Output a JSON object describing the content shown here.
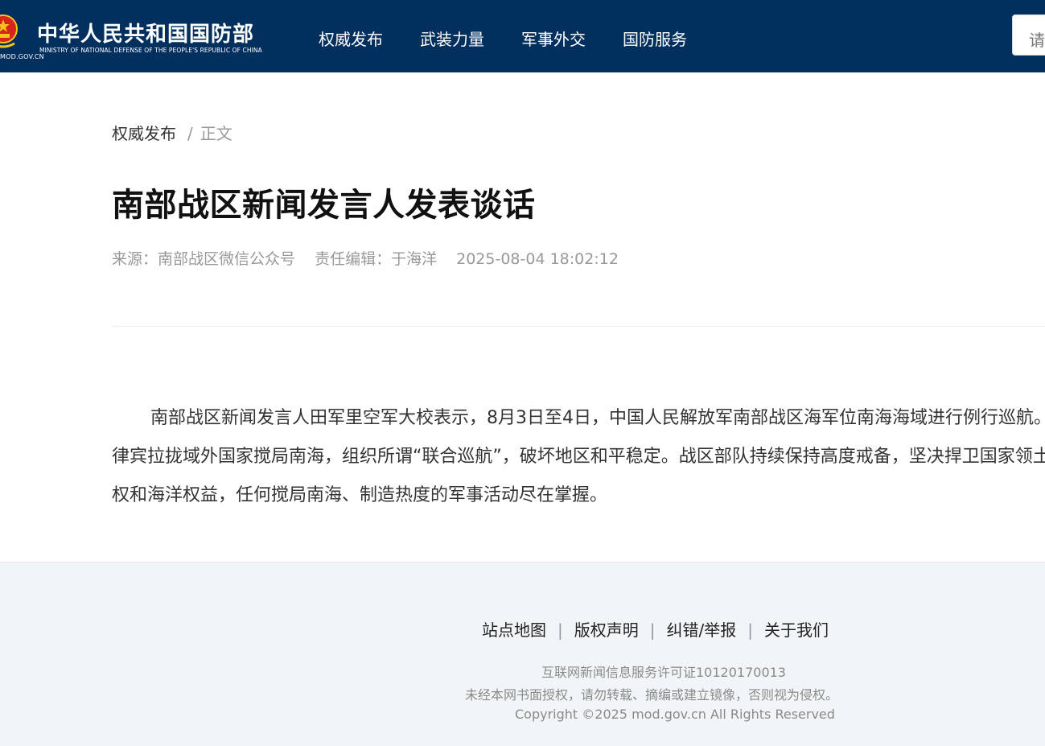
{
  "header": {
    "site_title": "中华人民共和国国防部",
    "site_subtitle": "MINISTRY OF NATIONAL DEFENSE OF THE PEOPLE'S REPUBLIC OF CHINA",
    "domain": "MOD.GOV.CN",
    "nav": [
      "权威发布",
      "武装力量",
      "军事外交",
      "国防服务"
    ],
    "search_placeholder": "请",
    "colors": {
      "bar": "#01305f",
      "emblem_red": "#d6261c",
      "emblem_gold": "#f5c518"
    },
    "icons": [
      "national-emblem-icon"
    ]
  },
  "breadcrumb": {
    "parent": "权威发布",
    "separator": "/",
    "current": "正文"
  },
  "article": {
    "title": "南部战区新闻发言人发表谈话",
    "source": "来源：南部战区微信公众号",
    "editor": "责任编辑：于海洋",
    "datetime": "2025-08-04 18:02:12",
    "body": "南部战区新闻发言人田军里空军大校表示，8月3日至4日，中国人民解放军南部战区海军位南海海域进行例行巡航。菲律宾拉拢域外国家搅局南海，组织所谓“联合巡航”，破坏地区和平稳定。战区部队持续保持高度戒备，坚决捍卫国家领土主权和海洋权益，任何搅局南海、制造热度的军事活动尽在掌握。"
  },
  "footer": {
    "links": [
      "站点地图",
      "版权声明",
      "纠错/举报",
      "关于我们"
    ],
    "separator": "|",
    "license": "互联网新闻信息服务许可证10120170013",
    "notice": "未经本网书面授权，请勿转载、摘编或建立镜像，否则视为侵权。",
    "copyright": "Copyright ©2025 mod.gov.cn All Rights Reserved"
  }
}
